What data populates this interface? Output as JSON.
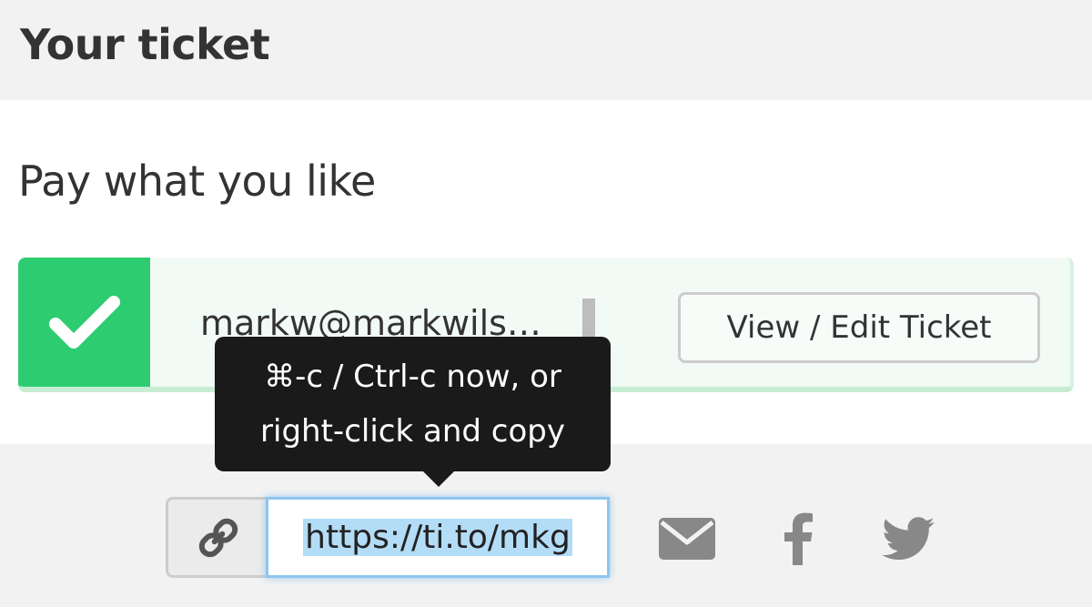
{
  "header": {
    "title": "Your ticket"
  },
  "ticket": {
    "type_name": "Pay what you like",
    "email": "markw@markwils…",
    "edit_button_label": "View / Edit Ticket",
    "status_color": "#2ecc71"
  },
  "share": {
    "link_icon": "link-icon",
    "link_value": "https://ti.to/mkg",
    "icons": [
      "envelope-icon",
      "facebook-icon",
      "twitter-icon"
    ]
  },
  "tooltip": {
    "line1": "⌘-c / Ctrl-c now, or",
    "line2": "right-click and copy"
  }
}
